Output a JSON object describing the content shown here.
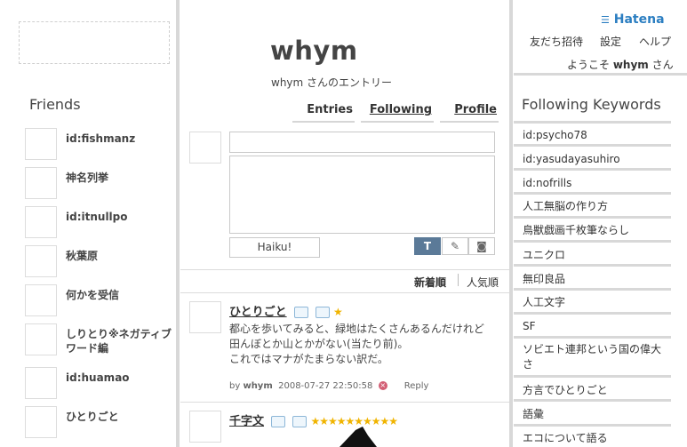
{
  "left": {
    "friends_title": "Friends",
    "friends": [
      "id:fishmanz",
      "神名列挙",
      "id:itnullpo",
      "秋葉原",
      "何かを受信",
      "しりとり※ネガティブワード編",
      "id:huamao",
      "ひとりごと"
    ]
  },
  "center": {
    "blog_name": "whym",
    "subtitle": "whym さんのエントリー",
    "tabs": [
      "Entries",
      "Following",
      "Profile"
    ],
    "haiku_button": "Haiku!",
    "tools": {
      "text": "T",
      "brush": "✎",
      "camera": "◙"
    },
    "sort": {
      "newest": "新着順",
      "popular": "人気順"
    },
    "entries": [
      {
        "title": "ひとりごと",
        "stars": "★",
        "body": [
          "都心を歩いてみると、緑地はたくさんあるんだけれど",
          "田んぼとか山とかがない(当たり前)。",
          "これではマナがたまらない訳だ。"
        ],
        "by_label": "by",
        "author": "whym",
        "timestamp": "2008-07-27 22:50:58",
        "reply": "Reply"
      },
      {
        "title": "千字文",
        "stars": "★★★★★★★★★★"
      }
    ]
  },
  "right": {
    "brand": "Hatena",
    "nav": [
      "友だち招待",
      "設定",
      "ヘルプ"
    ],
    "welcome_prefix": "ようこそ",
    "welcome_user": "whym",
    "welcome_suffix": "さん",
    "keywords_title": "Following Keywords",
    "keywords": [
      "id:psycho78",
      "id:yasudayasuhiro",
      "id:nofrills",
      "人工無脳の作り方",
      "鳥獣戯画千枚筆ならし",
      "ユニクロ",
      "無印良品",
      "人工文字",
      "SF",
      "ソビエト連邦という国の偉大さ",
      "方言でひとりごと",
      "語彙",
      "エコについて語る"
    ]
  },
  "colors": {
    "brand": "#2b7ec1",
    "star": "#f0b400",
    "active_tool": "#5b7a98"
  }
}
